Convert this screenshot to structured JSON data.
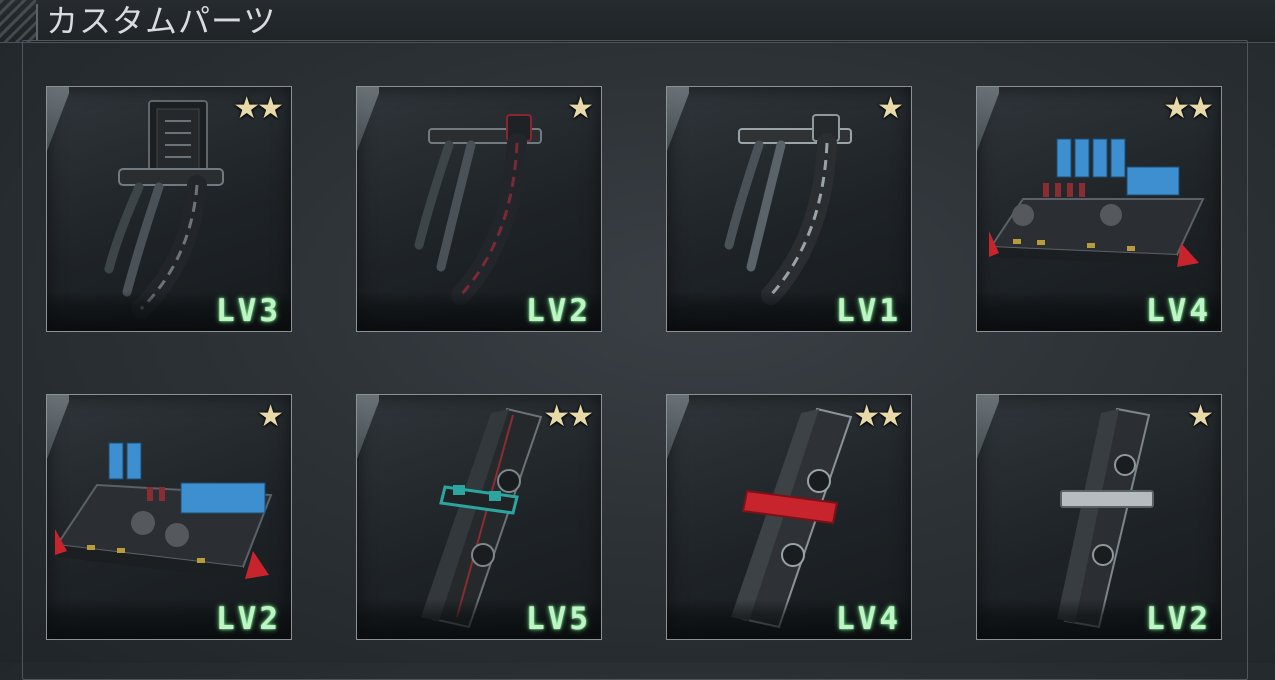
{
  "header": {
    "title": "カスタムパーツ"
  },
  "parts": [
    {
      "kind": "claw-dark",
      "stars": "★★",
      "level": "LV3"
    },
    {
      "kind": "claw-red",
      "stars": "★",
      "level": "LV2"
    },
    {
      "kind": "claw-silver",
      "stars": "★",
      "level": "LV1"
    },
    {
      "kind": "circuit-board-large",
      "stars": "★★",
      "level": "LV4"
    },
    {
      "kind": "circuit-board-small",
      "stars": "★",
      "level": "LV2"
    },
    {
      "kind": "barrel-teal",
      "stars": "★★",
      "level": "LV5"
    },
    {
      "kind": "barrel-red",
      "stars": "★★",
      "level": "LV4"
    },
    {
      "kind": "barrel-silver",
      "stars": "★",
      "level": "LV2"
    }
  ],
  "colors": {
    "level_text": "#bff5c5",
    "star": "#e7d9a8",
    "card_border": "#8a9296",
    "accent_red": "#c8242e",
    "accent_teal": "#2aa5a0",
    "chip_blue": "#3d8fcf"
  }
}
